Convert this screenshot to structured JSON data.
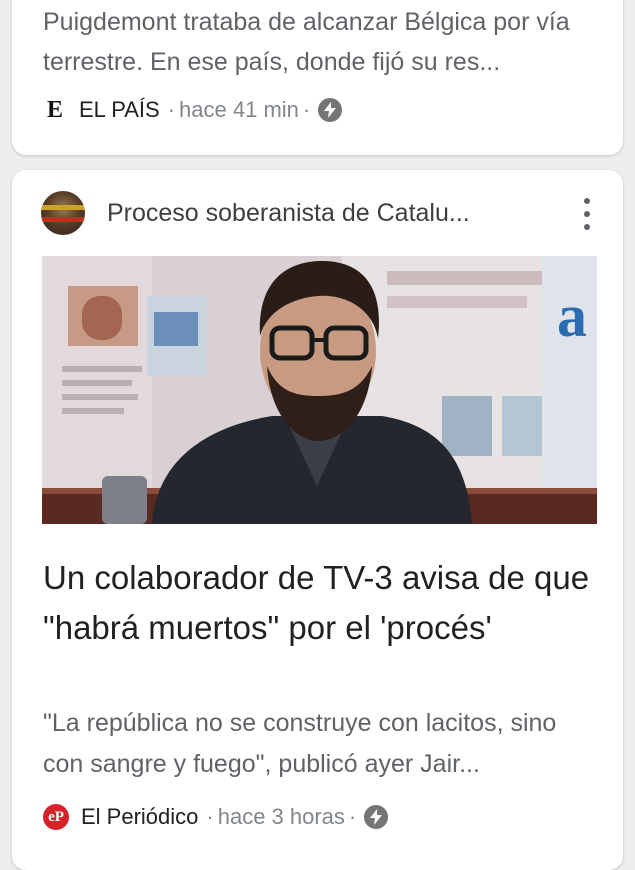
{
  "cards": [
    {
      "snippet": "Puigdemont trataba de alcanzar Bélgica por vía terrestre. En ese país, donde fijó su res...",
      "source": {
        "logo_text": "E",
        "name": "EL PAÍS",
        "separator": "·",
        "time": "hace 41 min",
        "amp_icon": "lightning-bolt-icon"
      }
    },
    {
      "topic": {
        "label": "Proceso soberanista de Catalu...",
        "avatar_icon": "topic-avatar",
        "menu_icon": "vertical-more-icon"
      },
      "image": {
        "description_icon": "news-hero-image"
      },
      "headline": "Un colaborador de TV-3 avisa de que \"habrá muertos\" por el 'procés'",
      "snippet": "\"La república no se construye con lacitos, sino con sangre y fuego\", publicó ayer Jair...",
      "source": {
        "logo_text": "eP",
        "logo_color": "#d6232a",
        "name": "El Periódico",
        "separator": "·",
        "time": "hace 3 horas",
        "amp_icon": "lightning-bolt-icon"
      }
    }
  ],
  "colors": {
    "background": "#eeeeee",
    "card": "#ffffff",
    "text_primary": "#202124",
    "text_secondary": "#5f6368",
    "meta": "#80868b"
  }
}
